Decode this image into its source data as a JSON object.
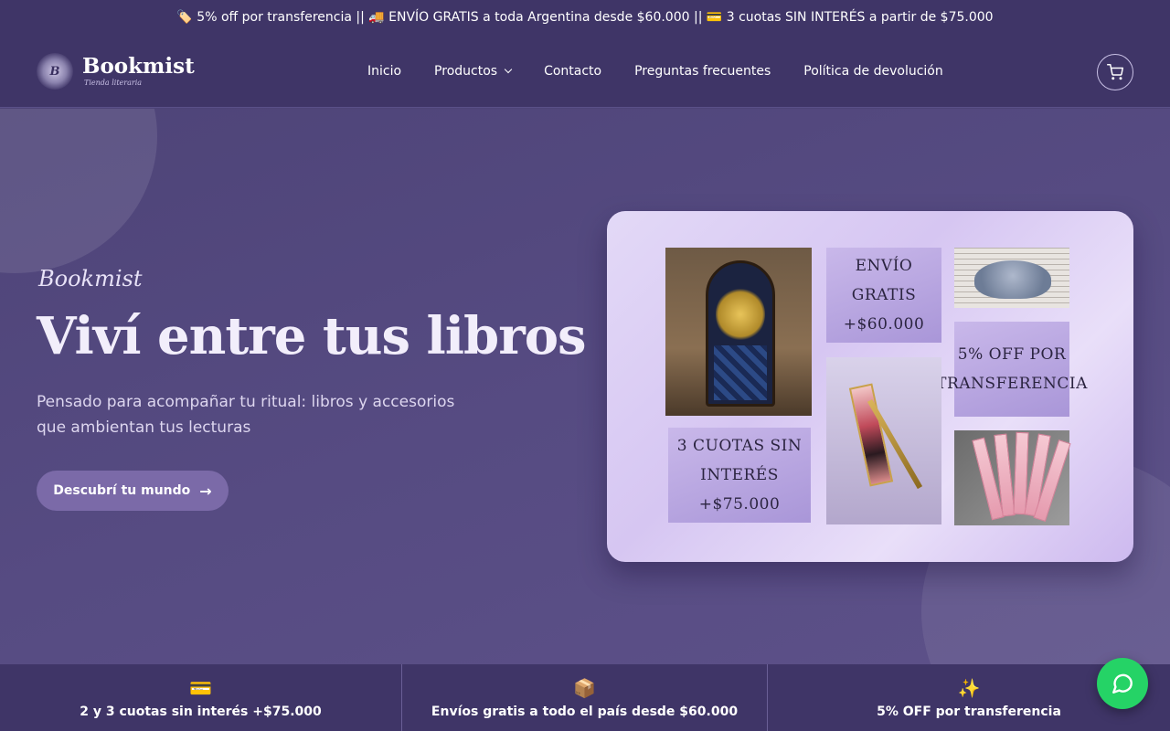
{
  "announcement": {
    "text": "🏷️ 5% off por transferencia || 🚚 ENVÍO GRATIS a toda Argentina desde $60.000 || 💳 3 cuotas SIN INTERÉS a partir de $75.000"
  },
  "header": {
    "logo_mark": "B",
    "logo_name": "Bookmist",
    "logo_tagline": "Tienda literaria",
    "nav": [
      {
        "label": "Inicio"
      },
      {
        "label": "Productos",
        "has_dropdown": true
      },
      {
        "label": "Contacto"
      },
      {
        "label": "Preguntas frecuentes"
      },
      {
        "label": "Política de devolución"
      }
    ],
    "cart_icon": "shopping-cart-icon"
  },
  "hero": {
    "eyebrow": "Bookmist",
    "headline": "Viví entre tus libros",
    "subtitle": "Pensado para acompañar tu ritual: libros y accesorios que ambientan tus lecturas",
    "cta_label": "Descubrí tu mundo",
    "cta_icon": "arrow-right-icon"
  },
  "promo_card": {
    "tiles": [
      {
        "text": "ENVÍO GRATIS +$60.000"
      },
      {
        "text": "5% OFF POR TRANSFERENCIA"
      },
      {
        "text": "3 CUOTAS SIN INTERÉS +$75.000"
      }
    ],
    "images": [
      "stained-glass-window-image",
      "bookmark-image",
      "book-holder-image",
      "rulers-image"
    ]
  },
  "features": [
    {
      "icon": "💳",
      "icon_name": "credit-card-icon",
      "label": "2 y 3 cuotas sin interés +$75.000"
    },
    {
      "icon": "📦",
      "icon_name": "package-icon",
      "label": "Envíos gratis a todo el país desde $60.000"
    },
    {
      "icon": "✨",
      "icon_name": "sparkles-icon",
      "label": "5% OFF por transferencia"
    }
  ],
  "whatsapp_icon": "whatsapp-icon",
  "colors": {
    "background": "#4e4478",
    "header": "#3f3567",
    "cta": "#7b6aa8",
    "whatsapp": "#25d366"
  }
}
